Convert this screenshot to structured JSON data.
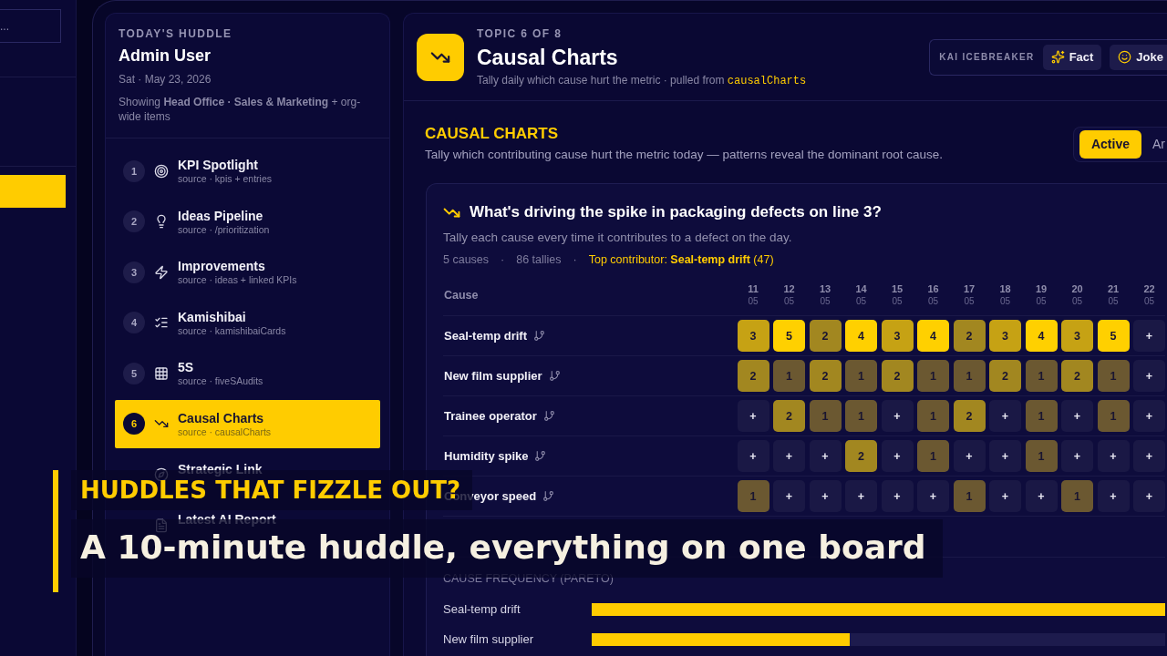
{
  "left_panel": {
    "field": {
      "placeholder": "..."
    },
    "nav_items": [
      {
        "selected": true
      }
    ]
  },
  "sidebar": {
    "eyebrow": "TODAY'S HUDDLE",
    "user": "Admin User",
    "date": "Sat · May 23, 2026",
    "scope": "Showing **Head Office · Sales & Marketing** + org-wide items",
    "topics": [
      {
        "number": "1",
        "title": "KPI Spotlight",
        "source": "source · kpis + entries",
        "kind": "spotlight",
        "selected": false
      },
      {
        "number": "2",
        "title": "Ideas Pipeline",
        "source": "source · /prioritization",
        "kind": "ideas",
        "selected": false
      },
      {
        "number": "3",
        "title": "Improvements",
        "source": "source · ideas + linked KPIs",
        "kind": "improvements",
        "selected": false
      },
      {
        "number": "4",
        "title": "Kamishibai",
        "source": "source · kamishibaiCards",
        "kind": "kamishibai",
        "selected": false
      },
      {
        "number": "5",
        "title": "5S",
        "source": "source · fiveSAudits",
        "kind": "audit",
        "selected": false
      },
      {
        "number": "6",
        "title": "Causal Charts",
        "source": "source · causalCharts",
        "kind": "causal",
        "selected": true
      },
      {
        "title": "Strategic Link",
        "kind": "strategic",
        "selected": false
      },
      {
        "title": "Latest AI Report",
        "kind": "report",
        "selected": false
      }
    ]
  },
  "header": {
    "eyebrow": "TOPIC 6 OF 8",
    "title": "Causal Charts",
    "subtitle": "Tally daily which cause hurt the metric · pulled from",
    "source": "causalCharts",
    "icebreaker": {
      "label": "KAI ICEBREAKER",
      "buttons": [
        {
          "label": "Fact",
          "kind": "fact"
        },
        {
          "label": "Joke",
          "kind": "joke"
        }
      ]
    }
  },
  "section": {
    "title": "CAUSAL CHARTS",
    "description": "Tally which contributing cause hurt the metric today — patterns reveal the dominant root cause.",
    "tabs": [
      {
        "label": "Active",
        "selected": true
      },
      {
        "label": "Ar",
        "selected": false
      }
    ]
  },
  "card": {
    "title": "What's driving the spike in packaging defects on line 3?",
    "subtitle": "Tally each cause every time it contributes to a defect on the day.",
    "stats": {
      "items": [
        "5 causes",
        "86 tallies"
      ],
      "separator": "·",
      "top_contributor": "Top contributor: **Seal-temp drift** (47)"
    },
    "table": {
      "cause_header": "Cause",
      "dates": [
        {
          "day": "11",
          "month": "05"
        },
        {
          "day": "12",
          "month": "05"
        },
        {
          "day": "13",
          "month": "05"
        },
        {
          "day": "14",
          "month": "05"
        },
        {
          "day": "15",
          "month": "05"
        },
        {
          "day": "16",
          "month": "05"
        },
        {
          "day": "17",
          "month": "05"
        },
        {
          "day": "18",
          "month": "05"
        },
        {
          "day": "19",
          "month": "05"
        },
        {
          "day": "20",
          "month": "05"
        },
        {
          "day": "21",
          "month": "05"
        },
        {
          "day": "22",
          "month": "05"
        }
      ],
      "rows": [
        {
          "cause": "Seal-temp drift",
          "cells": [
            "3",
            "5",
            "2",
            "4",
            "3",
            "4",
            "2",
            "3",
            "4",
            "3",
            "5",
            "+"
          ]
        },
        {
          "cause": "New film supplier",
          "cells": [
            "2",
            "1",
            "2",
            "1",
            "2",
            "1",
            "1",
            "2",
            "1",
            "2",
            "1",
            "+"
          ]
        },
        {
          "cause": "Trainee operator",
          "cells": [
            "+",
            "2",
            "1",
            "1",
            "+",
            "1",
            "2",
            "+",
            "1",
            "+",
            "1",
            "+"
          ]
        },
        {
          "cause": "Humidity spike",
          "cells": [
            "+",
            "+",
            "+",
            "2",
            "+",
            "1",
            "+",
            "+",
            "1",
            "+",
            "+",
            "+"
          ]
        },
        {
          "cause": "Conveyor speed",
          "cells": [
            "1",
            "+",
            "+",
            "+",
            "+",
            "+",
            "1",
            "+",
            "+",
            "1",
            "+",
            "+"
          ]
        }
      ]
    },
    "pareto": {
      "title": "CAUSE FREQUENCY (PARETO)",
      "bars": [
        {
          "label": "Seal-temp drift",
          "level": 1
        },
        {
          "label": "New film supplier",
          "level": 0.45
        }
      ]
    }
  },
  "caption": {
    "kicker": "HUDDLES THAT FIZZLE OUT?",
    "headline": "A 10-minute huddle, everything on one board"
  }
}
